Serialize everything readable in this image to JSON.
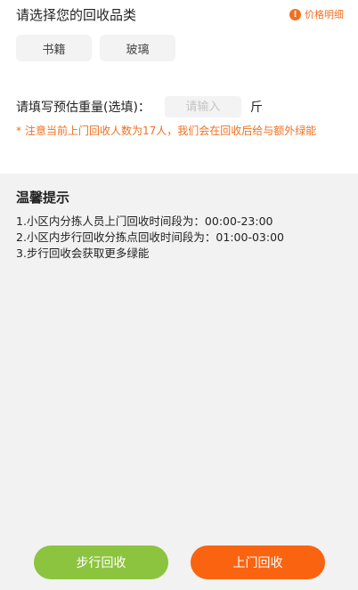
{
  "category": {
    "title": "请选择您的回收品类",
    "price_link": "价格明细",
    "price_icon": "!",
    "options": [
      "书籍",
      "玻璃"
    ]
  },
  "weight": {
    "label": "请填写预估重量(选填)：",
    "placeholder": "请输入",
    "value": "",
    "unit": "斤"
  },
  "notice": {
    "star": "*",
    "text": "注意当前上门回收人数为17人，我们会在回收后给与额外绿能"
  },
  "tips": {
    "title": "温馨提示",
    "items": [
      "1.小区内分拣人员上门回收时间段为：00:00-23:00",
      "2.小区内步行回收分拣点回收时间段为：01:00-03:00",
      "3.步行回收会获取更多绿能"
    ]
  },
  "actions": {
    "walk_label": "步行回收",
    "door_label": "上门回收"
  },
  "colors": {
    "accent": "#f07020",
    "walk_button": "#8cc43f",
    "door_button": "#fa6411",
    "tips_bg": "#f2f2f2"
  }
}
